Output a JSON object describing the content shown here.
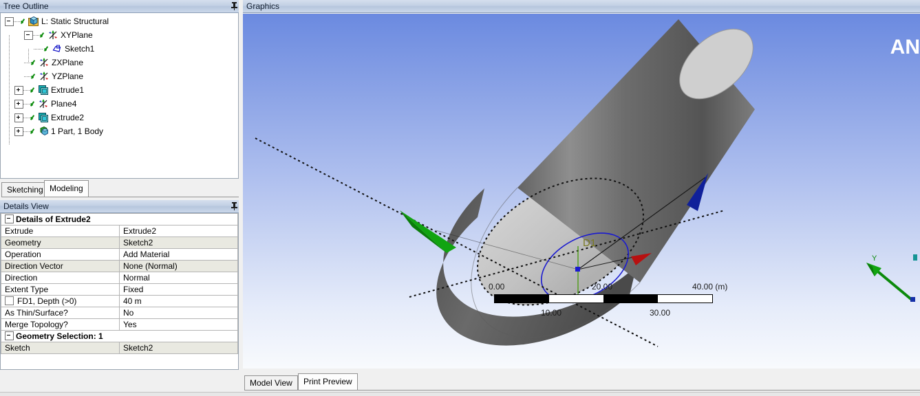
{
  "panels": {
    "tree": {
      "title": "Tree Outline",
      "pin_icon": "pin-icon"
    },
    "details": {
      "title": "Details View",
      "pin_icon": "pin-icon"
    },
    "graphics": {
      "title": "Graphics"
    }
  },
  "tree": {
    "items": [
      {
        "label": "L: Static Structural",
        "icon": "model-cube-icon",
        "expander": "minus",
        "depth": 0,
        "checked": true
      },
      {
        "label": "XYPlane",
        "icon": "plane-axes-icon",
        "expander": "minus",
        "depth": 1,
        "checked": true
      },
      {
        "label": "Sketch1",
        "icon": "sketch-icon",
        "expander": "none",
        "depth": 2,
        "checked": true
      },
      {
        "label": "ZXPlane",
        "icon": "plane-axes-icon",
        "expander": "none",
        "depth": 1,
        "checked": true
      },
      {
        "label": "YZPlane",
        "icon": "plane-axes-icon",
        "expander": "none",
        "depth": 1,
        "checked": true
      },
      {
        "label": "Extrude1",
        "icon": "extrude-icon",
        "expander": "plus",
        "depth": 1,
        "checked": true
      },
      {
        "label": "Plane4",
        "icon": "plane-axes-icon",
        "expander": "plus",
        "depth": 1,
        "checked": true
      },
      {
        "label": "Extrude2",
        "icon": "extrude-icon",
        "expander": "plus",
        "depth": 1,
        "checked": true
      },
      {
        "label": "1 Part, 1 Body",
        "icon": "part-body-icon",
        "expander": "plus",
        "depth": 1,
        "checked": true
      }
    ]
  },
  "tree_tabs": [
    {
      "label": "Sketching",
      "active": false
    },
    {
      "label": "Modeling",
      "active": true
    }
  ],
  "details": {
    "rows": [
      {
        "type": "group",
        "label": "Details of Extrude2"
      },
      {
        "type": "row",
        "label": "Extrude",
        "value": "Extrude2",
        "alt": false
      },
      {
        "type": "row",
        "label": "Geometry",
        "value": "Sketch2",
        "alt": true
      },
      {
        "type": "row",
        "label": "Operation",
        "value": "Add Material",
        "alt": false
      },
      {
        "type": "row",
        "label": "Direction Vector",
        "value": "None (Normal)",
        "alt": true
      },
      {
        "type": "row",
        "label": "Direction",
        "value": "Normal",
        "alt": false
      },
      {
        "type": "row",
        "label": "Extent Type",
        "value": "Fixed",
        "alt": false
      },
      {
        "type": "row",
        "label": "FD1,  Depth (>0)",
        "value": "40 m",
        "alt": false,
        "checkbox": true
      },
      {
        "type": "row",
        "label": "As Thin/Surface?",
        "value": "No",
        "alt": false
      },
      {
        "type": "row",
        "label": "Merge Topology?",
        "value": "Yes",
        "alt": false
      },
      {
        "type": "group",
        "label": "Geometry Selection: 1"
      },
      {
        "type": "row",
        "label": "Sketch",
        "value": "Sketch2",
        "alt": true
      }
    ]
  },
  "graphics": {
    "logo_text": "AN",
    "tabs": [
      {
        "label": "Model View",
        "active": false
      },
      {
        "label": "Print Preview",
        "active": true
      }
    ],
    "dimension_label": "D1",
    "triad": {
      "y_label": "Y"
    },
    "scale": {
      "unit": "(m)",
      "top_labels": [
        {
          "text": "0.00",
          "left_pct": 0
        },
        {
          "text": "20.00",
          "left_pct": 50
        },
        {
          "text": "40.00 (m)",
          "left_pct": 100
        }
      ],
      "bottom_labels": [
        {
          "text": "10.00",
          "left_pct": 25
        },
        {
          "text": "30.00",
          "left_pct": 75
        }
      ],
      "segments": [
        "dark",
        "light",
        "dark",
        "light"
      ]
    }
  },
  "colors": {
    "viewport_top": "#6b8ae0",
    "viewport_bottom": "#f8fafd",
    "titlebar": "#c2d0e4",
    "check_green": "#0a8a0a",
    "axis_x_red": "#cc1414",
    "axis_y_green": "#0c8a0c",
    "axis_z_blue": "#1a2fb0",
    "sketch_blue": "#2222cc",
    "dimension_olive": "#80801a",
    "alt_row": "#e9e9e1"
  }
}
